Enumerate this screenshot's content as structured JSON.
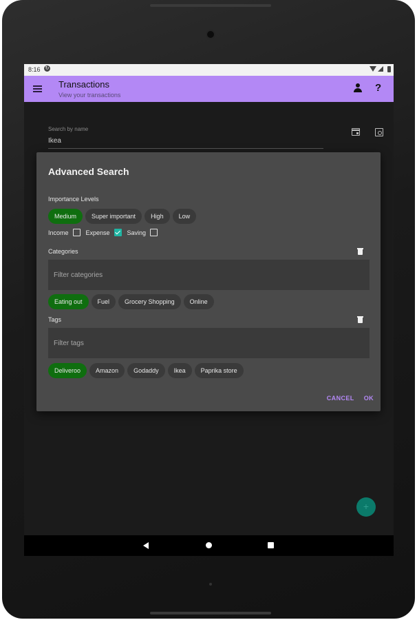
{
  "status_bar": {
    "time": "8:16"
  },
  "app_bar": {
    "title": "Transactions",
    "subtitle": "View your transactions"
  },
  "search": {
    "label": "Search by name",
    "value": "Ikea"
  },
  "dialog": {
    "title": "Advanced Search",
    "importance": {
      "label": "Importance Levels",
      "chips": [
        {
          "label": "Medium",
          "selected": true
        },
        {
          "label": "Super important",
          "selected": false
        },
        {
          "label": "High",
          "selected": false
        },
        {
          "label": "Low",
          "selected": false
        }
      ]
    },
    "types": [
      {
        "label": "Income",
        "checked": false
      },
      {
        "label": "Expense",
        "checked": true
      },
      {
        "label": "Saving",
        "checked": false
      }
    ],
    "categories": {
      "label": "Categories",
      "placeholder": "Filter categories",
      "chips": [
        {
          "label": "Eating out",
          "selected": true
        },
        {
          "label": "Fuel",
          "selected": false
        },
        {
          "label": "Grocery Shopping",
          "selected": false
        },
        {
          "label": "Online",
          "selected": false
        }
      ]
    },
    "tags": {
      "label": "Tags",
      "placeholder": "Filter tags",
      "chips": [
        {
          "label": "Deliveroo",
          "selected": true
        },
        {
          "label": "Amazon",
          "selected": false
        },
        {
          "label": "Godaddy",
          "selected": false
        },
        {
          "label": "Ikea",
          "selected": false
        },
        {
          "label": "Paprika store",
          "selected": false
        }
      ]
    },
    "cancel_label": "CANCEL",
    "ok_label": "OK"
  },
  "fab": {
    "glyph": "+"
  },
  "colors": {
    "app_bar": "#b388f5",
    "chip_selected": "#0f6e0f",
    "accent": "#b388f5",
    "fab": "#0b7a6a"
  }
}
